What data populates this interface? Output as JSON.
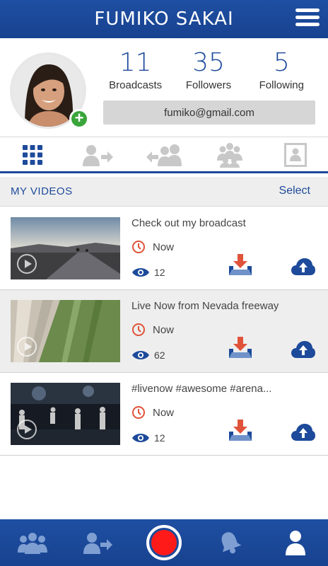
{
  "header": {
    "title": "FUMIKO SAKAI",
    "menu_icon": "hamburger-menu-icon"
  },
  "profile": {
    "stats": [
      {
        "value": "11",
        "label": "Broadcasts"
      },
      {
        "value": "35",
        "label": "Followers"
      },
      {
        "value": "5",
        "label": "Following"
      }
    ],
    "email": "fumiko@gmail.com"
  },
  "tabs": [
    {
      "name": "grid",
      "icon": "grid-icon",
      "active": true
    },
    {
      "name": "share",
      "icon": "user-share-icon",
      "active": false
    },
    {
      "name": "users",
      "icon": "users-icon",
      "active": false
    },
    {
      "name": "group",
      "icon": "group-icon",
      "active": false
    },
    {
      "name": "contact",
      "icon": "contact-card-icon",
      "active": false
    }
  ],
  "section": {
    "label": "MY VIDEOS",
    "select": "Select"
  },
  "videos": [
    {
      "title": "Check out my broadcast",
      "time": "Now",
      "views": "12"
    },
    {
      "title": "Live Now from Nevada freeway",
      "time": "Now",
      "views": "62"
    },
    {
      "title": "#livenow #awesome #arena...",
      "time": "Now",
      "views": "12"
    }
  ],
  "colors": {
    "primary": "#1d4a9a",
    "accent": "#e0533a",
    "record": "#ff1a1a",
    "add": "#3aa53a"
  }
}
